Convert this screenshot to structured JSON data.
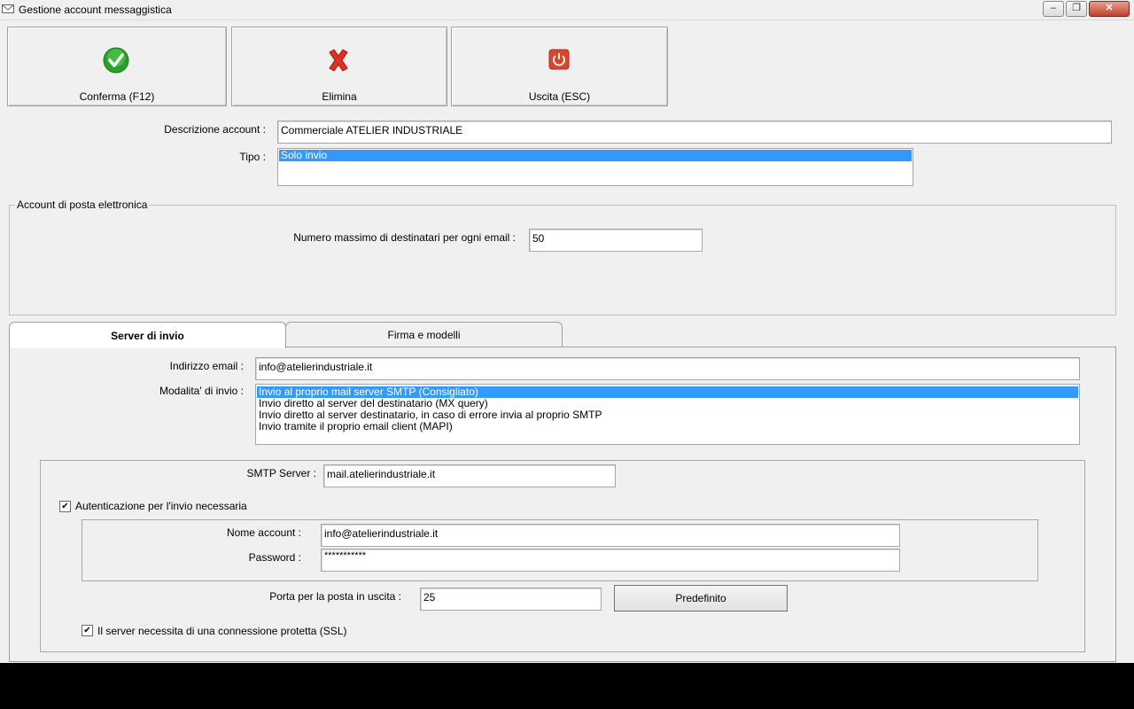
{
  "window": {
    "title": "Gestione account messaggistica",
    "minimize_label": "–",
    "restore_label": "❐",
    "close_label": "✕"
  },
  "toolbar": {
    "confirm_label": "Conferma (F12)",
    "delete_label": "Elimina",
    "exit_label": "Uscita (ESC)",
    "confirm_icon": "checkmark-icon",
    "delete_icon": "red-x-icon",
    "exit_icon": "power-icon"
  },
  "account": {
    "description_label": "Descrizione account :",
    "description_value": "Commerciale ATELIER INDUSTRIALE",
    "type_label": "Tipo :",
    "type_options": [
      "Solo invio"
    ],
    "type_selected": "Solo invio"
  },
  "email_group": {
    "title": "Account di posta elettronica",
    "max_recipients_label": "Numero massimo di destinatari per ogni email :",
    "max_recipients_value": "50"
  },
  "tabs": [
    {
      "label": "Server di invio",
      "active": true
    },
    {
      "label": "Firma e modelli",
      "active": false
    }
  ],
  "server": {
    "email_label": "Indirizzo email :",
    "email_value": "info@atelierindustriale.it",
    "mode_label": "Modalita' di invio :",
    "mode_options": [
      "Invio al proprio mail server SMTP (Consigliato)",
      "Invio diretto al server del destinatario (MX query)",
      "Invio diretto al server destinatario, in caso di errore invia al proprio SMTP",
      "Invio tramite il proprio email client (MAPI)"
    ],
    "mode_selected": "Invio al proprio mail server SMTP (Consigliato)",
    "smtp_label": "SMTP Server :",
    "smtp_value": "mail.atelierindustriale.it",
    "auth_label": "Autenticazione per l'invio necessaria",
    "auth_checked": true,
    "account_name_label": "Nome account :",
    "account_name_value": "info@atelierindustriale.it",
    "password_label": "Password :",
    "password_value": "***********",
    "port_label": "Porta per la posta in uscita :",
    "port_value": "25",
    "default_button_label": "Predefinito",
    "ssl_label": "Il server necessita di una connessione protetta (SSL)",
    "ssl_checked": true,
    "check_mark": "✔"
  },
  "colors": {
    "selection": "#3399ff",
    "confirm_green": "#2aa02a",
    "delete_red": "#e03020",
    "exit_red": "#d9462c"
  }
}
